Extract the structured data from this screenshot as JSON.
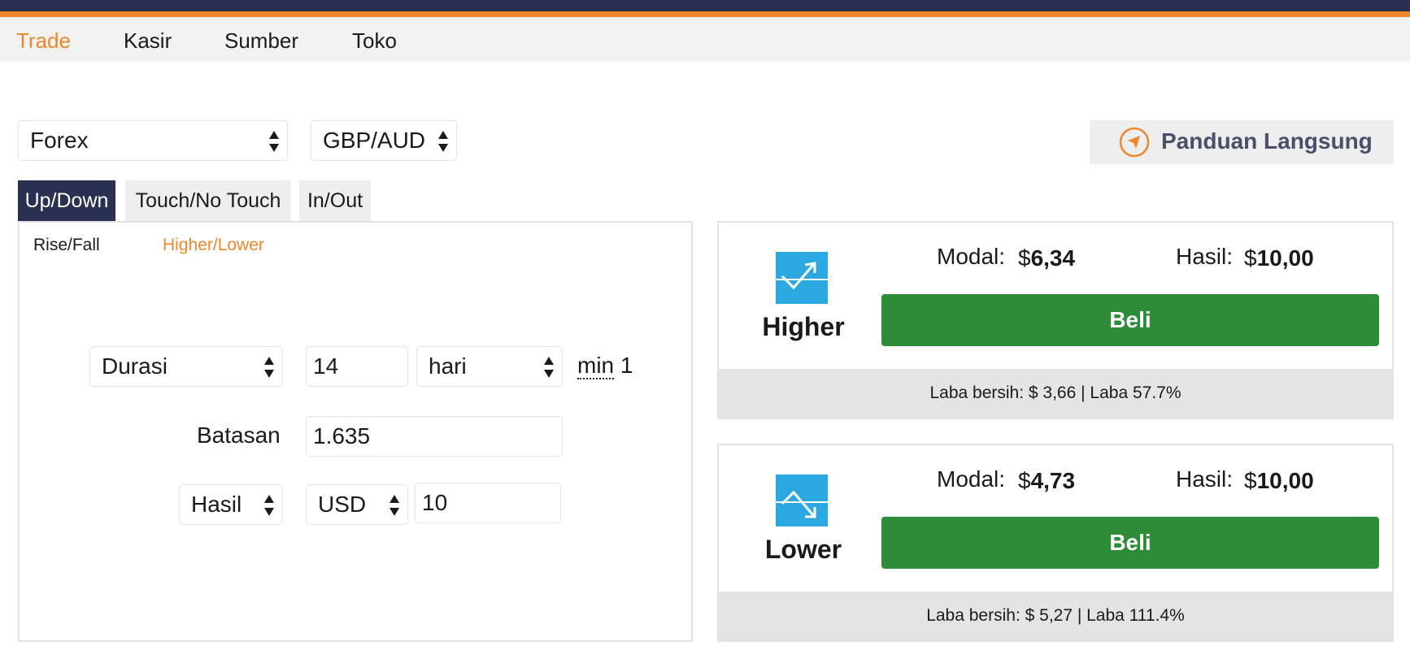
{
  "nav": {
    "items": [
      {
        "label": "Trade",
        "active": true
      },
      {
        "label": "Kasir",
        "active": false
      },
      {
        "label": "Sumber",
        "active": false
      },
      {
        "label": "Toko",
        "active": false
      }
    ]
  },
  "market": {
    "value": "Forex"
  },
  "symbol": {
    "value": "GBP/AUD"
  },
  "guide": {
    "label": "Panduan Langsung"
  },
  "tabs": [
    {
      "label": "Up/Down",
      "active": true
    },
    {
      "label": "Touch/No Touch",
      "active": false
    },
    {
      "label": "In/Out",
      "active": false
    }
  ],
  "subtabs": [
    {
      "label": "Rise/Fall",
      "active": false
    },
    {
      "label": "Higher/Lower",
      "active": true
    }
  ],
  "form": {
    "duration_type": "Durasi",
    "duration_value": "14",
    "duration_unit": "hari",
    "min_label": "min",
    "min_value": "1",
    "barrier_label": "Batasan",
    "barrier_value": "1.635",
    "payout_type": "Hasil",
    "currency": "USD",
    "amount": "10"
  },
  "contracts": {
    "higher": {
      "title": "Higher",
      "stake_label": "Modal:",
      "stake_currency": "$",
      "stake_value": "6,34",
      "payout_label": "Hasil:",
      "payout_currency": "$",
      "payout_value": "10,00",
      "buy_label": "Beli",
      "footer": "Laba bersih: $ 3,66 | Laba 57.7%"
    },
    "lower": {
      "title": "Lower",
      "stake_label": "Modal:",
      "stake_currency": "$",
      "stake_value": "4,73",
      "payout_label": "Hasil:",
      "payout_currency": "$",
      "payout_value": "10,00",
      "buy_label": "Beli",
      "footer": "Laba bersih: $ 5,27 | Laba 111.4%"
    }
  },
  "colors": {
    "brand_dark": "#2a3052",
    "accent": "#f0862a",
    "buy_green": "#2e8b37",
    "icon_blue": "#2ba8e0"
  }
}
